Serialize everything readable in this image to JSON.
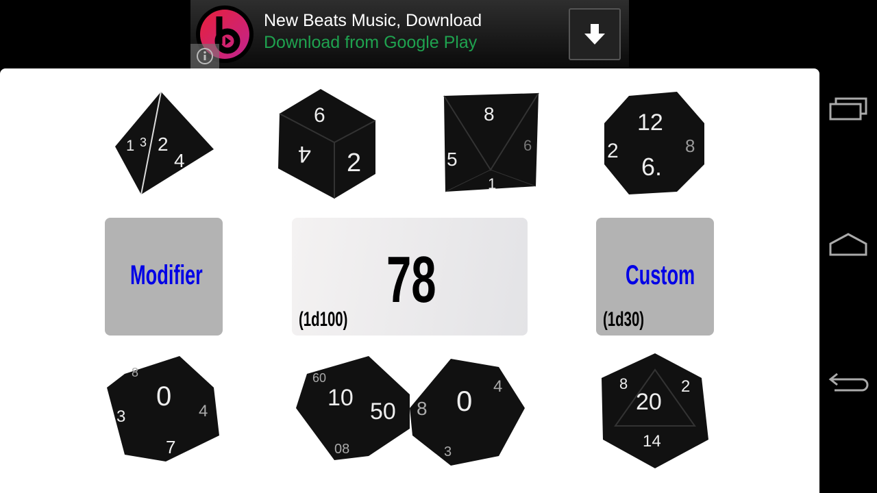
{
  "ad": {
    "title": "New Beats Music, Download",
    "subtitle": "Download from Google Play",
    "icons": [
      "beats-logo",
      "download-arrow-icon",
      "info-icon"
    ]
  },
  "dice": {
    "d4": [
      "1",
      "2",
      "3",
      "4"
    ],
    "d6": [
      "6",
      "4",
      "2"
    ],
    "d8": [
      "8",
      "5",
      "6",
      "1"
    ],
    "d12": [
      "12",
      "2",
      "6.",
      "8"
    ],
    "d10": [
      "0",
      "8",
      "4",
      "7",
      "3"
    ],
    "d100a": [
      "10",
      "50",
      "08",
      "60"
    ],
    "d100b": [
      "0",
      "8",
      "4",
      "3"
    ],
    "d20": [
      "20",
      "8",
      "2",
      "14"
    ]
  },
  "modifier": {
    "label": "Modifier"
  },
  "result": {
    "value": "78",
    "roll": "(1d100)"
  },
  "custom": {
    "label": "Custom",
    "roll": "(1d30)"
  },
  "colors": {
    "button_label": "#0000e6",
    "button_bg": "#b3b3b3",
    "ad_subtitle": "#1fa24f"
  },
  "nav": {
    "icons": [
      "recent-apps-icon",
      "home-icon",
      "back-icon"
    ]
  }
}
